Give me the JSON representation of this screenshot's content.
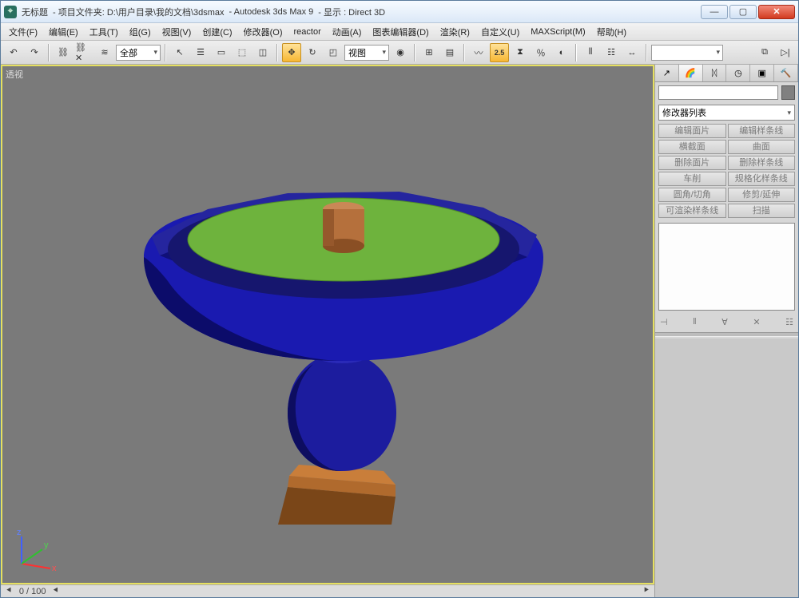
{
  "window": {
    "icon_letter": "⌖",
    "title_untitled": "无标题",
    "title_project": "- 项目文件夹: D:\\用户目录\\我的文档\\3dsmax",
    "title_app": "- Autodesk 3ds Max 9",
    "title_display": "- 显示 : Direct 3D",
    "minimize": "—",
    "maximize": "▢",
    "close": "✕"
  },
  "menus": {
    "file": "文件(F)",
    "edit": "编辑(E)",
    "tools": "工具(T)",
    "group": "组(G)",
    "views": "视图(V)",
    "create": "创建(C)",
    "modifiers": "修改器(O)",
    "reactor": "reactor",
    "animation": "动画(A)",
    "graph": "图表编辑器(D)",
    "render": "渲染(R)",
    "customize": "自定义(U)",
    "maxscript": "MAXScript(M)",
    "help": "帮助(H)"
  },
  "toolbar": {
    "undo": "↶",
    "redo": "↷",
    "link": "⛓",
    "unlink": "⛓✕",
    "bind": "≋",
    "filter": "全部",
    "select": "↖",
    "byname": "☰",
    "rect": "▭",
    "window": "⬚",
    "crossing": "◫",
    "move": "✥",
    "rotate": "↻",
    "scale": "◰",
    "refcoord": "视图",
    "pivot": "◉",
    "manip": "⊞",
    "layers": "▤",
    "curve": "〰",
    "snap25": "2.5",
    "angle": "⧗",
    "percent": "％",
    "spinner": "◐",
    "mirror": "⦀",
    "align_grp": "☷",
    "align": "↔",
    "named": " ",
    "end_group": "⧉",
    "end_arrow": "▷|"
  },
  "viewport": {
    "label": "透视",
    "axis_x": "x",
    "axis_y": "y",
    "axis_z": "z"
  },
  "timeline": {
    "left_arrow": "⯇",
    "value": "0 / 100",
    "mid_arrow": "⯇",
    "right_arrow": "⯈"
  },
  "panel": {
    "tab_create": "↗",
    "tab_modify": "🌈",
    "tab_hierarchy": "ᛞ",
    "tab_motion": "◷",
    "tab_display": "▣",
    "tab_util": "🔨",
    "name_value": "",
    "color": "#808080",
    "mod_list": "修改器列表",
    "buttons": {
      "r0c0": "编辑面片",
      "r0c1": "编辑样条线",
      "r1c0": "横截面",
      "r1c1": "曲面",
      "r2c0": "删除面片",
      "r2c1": "删除样条线",
      "r3c0": "车削",
      "r3c1": "规格化样条线",
      "r4c0": "圆角/切角",
      "r4c1": "修剪/延伸",
      "r5c0": "可渲染样条线",
      "r5c1": "扫描"
    },
    "stack_icons": {
      "pin": "⊣",
      "show": "‖",
      "unique": "∀",
      "remove": "✕",
      "config": "☷"
    }
  },
  "colors": {
    "accent_yellow": "#f7b733",
    "viewport_border": "#e6e060",
    "close_red": "#d23b20"
  }
}
